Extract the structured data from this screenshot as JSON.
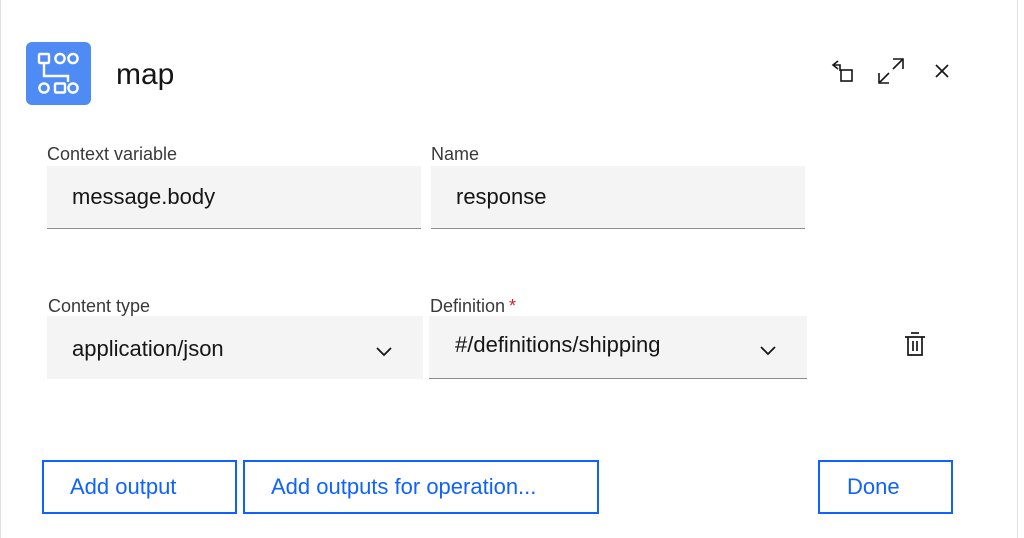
{
  "header": {
    "title": "map",
    "node_icon": "map-node-icon",
    "actions": [
      {
        "name": "reset-view-icon",
        "label": ""
      },
      {
        "name": "maximize-icon",
        "label": ""
      },
      {
        "name": "close-icon",
        "label": ""
      }
    ]
  },
  "form": {
    "context_variable": {
      "label": "Context variable",
      "value": "message.body"
    },
    "name": {
      "label": "Name",
      "value": "response"
    },
    "content_type": {
      "label": "Content type",
      "value": "application/json"
    },
    "definition": {
      "label": "Definition",
      "required_mark": "*",
      "value": "#/definitions/shipping"
    }
  },
  "buttons": {
    "add_output": "Add output",
    "add_outputs_for_operation": "Add outputs for operation...",
    "done": "Done"
  },
  "colors": {
    "accent": "#0f62fe",
    "node_icon_bg": "#4e8bf5",
    "field_bg": "#f4f4f4",
    "required": "#da1e28"
  }
}
